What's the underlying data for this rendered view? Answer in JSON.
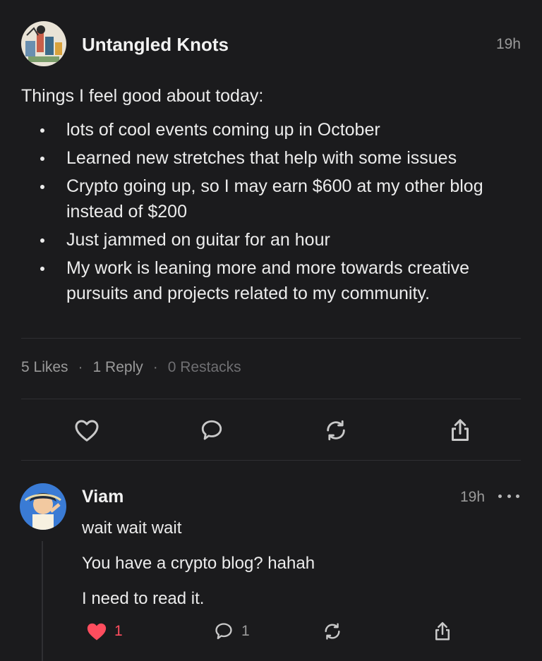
{
  "post": {
    "author": "Untangled Knots",
    "time": "19h",
    "intro": "Things I feel good about today:",
    "bullets": [
      "lots of cool events coming up in October",
      "Learned new stretches that help with some issues",
      "Crypto going up, so I may earn $600 at my other blog instead of $200",
      "Just jammed on guitar for an hour",
      "My work is leaning more and more towards creative pursuits and projects related to my community."
    ],
    "stats": {
      "likes": "5 Likes",
      "separator": "·",
      "replies": "1 Reply",
      "restacks": "0 Restacks"
    },
    "actions": {
      "like_icon": "heart-outline-icon",
      "comment_icon": "comment-bubble-icon",
      "restack_icon": "restack-icon",
      "share_icon": "share-icon"
    }
  },
  "reply": {
    "author": "Viam",
    "time": "19h",
    "more_icon": "more-horizontal-icon",
    "lines": [
      "wait wait wait",
      "You have a crypto blog? hahah",
      "I need to read it."
    ],
    "like_count": "1",
    "comment_count": "1",
    "liked": true
  },
  "colors": {
    "background": "#1b1b1d",
    "liked_red": "#ff4d5e",
    "muted": "#9a9a9a"
  }
}
